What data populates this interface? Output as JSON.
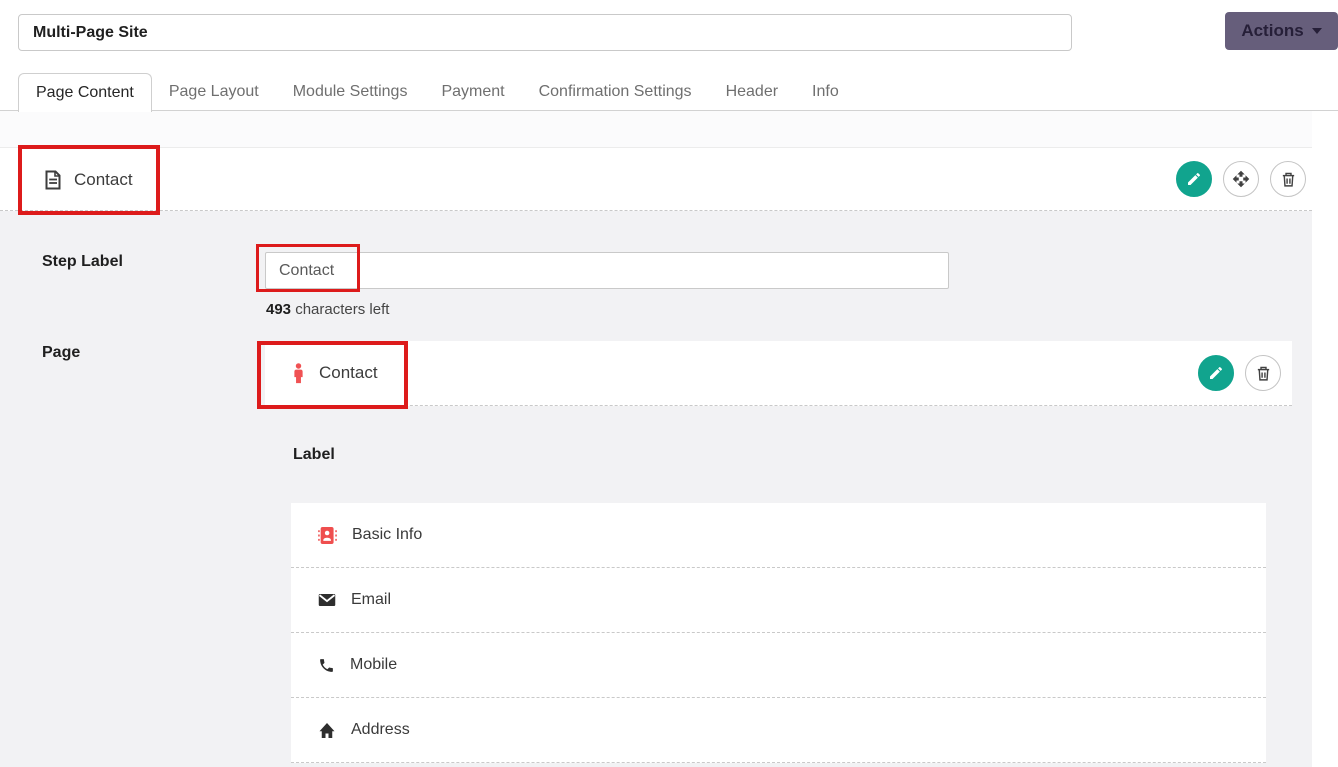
{
  "header": {
    "form_title_value": "Multi-Page Site",
    "actions_label": "Actions"
  },
  "tabs": [
    {
      "label": "Page Content",
      "active": true
    },
    {
      "label": "Page Layout",
      "active": false
    },
    {
      "label": "Module Settings",
      "active": false
    },
    {
      "label": "Payment",
      "active": false
    },
    {
      "label": "Confirmation Settings",
      "active": false
    },
    {
      "label": "Header",
      "active": false
    },
    {
      "label": "Info",
      "active": false
    }
  ],
  "section": {
    "title": "Contact",
    "title_icon": "form-page-icon",
    "header_buttons": [
      "edit-pencil",
      "move",
      "delete"
    ],
    "step_label": {
      "label": "Step Label",
      "value": "Contact",
      "chars_left_count": "493",
      "chars_left_text": "characters left"
    },
    "page": {
      "label": "Page",
      "item_title": "Contact",
      "item_icon": "person-icon",
      "buttons": [
        "edit-pencil",
        "delete"
      ]
    },
    "fields": {
      "heading": "Label",
      "items": [
        {
          "label": "Basic Info",
          "icon": "address-book-icon"
        },
        {
          "label": "Email",
          "icon": "envelope-icon"
        },
        {
          "label": "Mobile",
          "icon": "phone-icon"
        },
        {
          "label": "Address",
          "icon": "home-icon"
        }
      ]
    }
  },
  "annotations": {
    "color": "#dd1b1b",
    "boxes": [
      "section-title",
      "step-label-input-value",
      "page-item"
    ]
  },
  "colors": {
    "teal_accent": "#11a48e",
    "actions_button_bg": "#665e7b",
    "icon_red": "#f05153",
    "body_gray": "#f2f2f4"
  }
}
